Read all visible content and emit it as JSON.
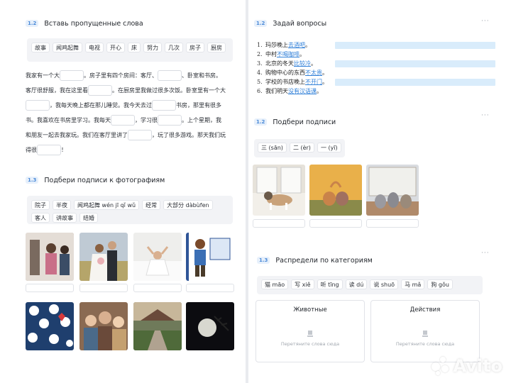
{
  "left": {
    "section1": {
      "badge": "1.2",
      "title": "Вставь пропущенные слова",
      "chips": [
        "故事",
        "闻鸡起舞",
        "电视",
        "开心",
        "床",
        "努力",
        "几次",
        "房子",
        "厨房"
      ],
      "text": {
        "l1a": "我家有一个大",
        "l1b": "。房子里有四个房间：客厅、",
        "l1c": "、卧室和书房。",
        "l2a": "客厅很舒服，我在这里看",
        "l2b": "。在厨房里我做过很多次饭。卧室里有一个大",
        "l3a": "，我每天晚上都在那儿睡觉。我今天去过",
        "l3b": "书房，那里有很多",
        "l4a": "书。我喜欢在书房里学习。我每天",
        "l4b": "，学习很",
        "l4c": "。上个星期，我",
        "l5a": "和朋友一起去我家玩。我们在客厅里讲了",
        "l5b": "，玩了很多游戏。那天我们玩",
        "l6a": "得很",
        "l6b": "！"
      }
    },
    "section2": {
      "badge": "1.3",
      "title": "Подбери подписи к фотографиям",
      "chips": [
        "院子",
        "半夜",
        "闻鸡起舞 wén jī qǐ wǔ",
        "经常",
        "大部分 dàbùfen",
        "客人",
        "讲故事",
        "结婚"
      ]
    }
  },
  "right": {
    "section1": {
      "badge": "1.2",
      "title": "Задай вопросы",
      "dots": "···",
      "questions": [
        {
          "num": "1.",
          "text": "玛莎晚上",
          "link": "去酒吧",
          "end": "。"
        },
        {
          "num": "2.",
          "text": "中村",
          "link": "不喝咖啡",
          "end": "。"
        },
        {
          "num": "3.",
          "text": "北京的冬天",
          "link": "比较冷",
          "end": "。"
        },
        {
          "num": "4.",
          "text": "购物中心的东西",
          "link": "不太贵",
          "end": "。"
        },
        {
          "num": "5.",
          "text": "学校的书店晚上",
          "link": "不开门",
          "end": "。"
        },
        {
          "num": "6.",
          "text": "我们明天",
          "link": "没有汉语课",
          "end": "。"
        }
      ]
    },
    "section2": {
      "badge": "1.2",
      "title": "Подбери подписи",
      "dots": "···",
      "chips": [
        "三 (sān)",
        "二 (èr)",
        "一 (yī)"
      ]
    },
    "section3": {
      "badge": "1.3",
      "title": "Распредели по категориям",
      "dots": "···",
      "chips": [
        "猫 māo",
        "写 xiě",
        "听 tīng",
        "读 dú",
        "说 shuō",
        "马 mǎ",
        "狗 gǒu"
      ],
      "bins": [
        {
          "title": "Животные",
          "hint": "Перетяните слова сюда"
        },
        {
          "title": "Действия",
          "hint": "Перетяните слова сюда"
        }
      ]
    },
    "topdots": "···"
  },
  "watermark": {
    "text": "Avito"
  },
  "colors": {
    "accent": "#4b8ad8",
    "link": "#2f7fd8",
    "answer": "#d9ecfb"
  }
}
